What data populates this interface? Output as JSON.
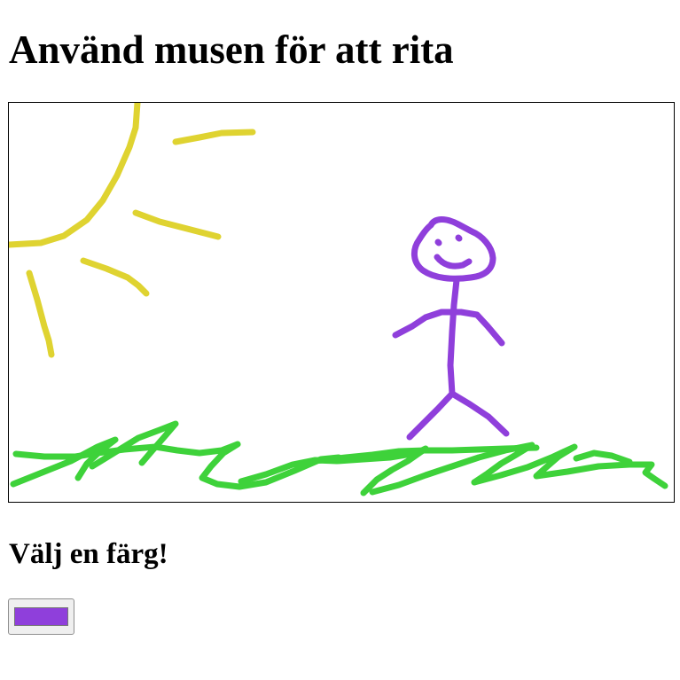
{
  "page": {
    "title": "Använd musen för att rita",
    "color_prompt": "Välj en färg!"
  },
  "color_picker": {
    "selected_color": "#8f3fdb"
  },
  "drawing": {
    "stroke_colors": {
      "sun": "#dfd331",
      "figure": "#8f3fdb",
      "grass": "#3ed23a"
    }
  }
}
